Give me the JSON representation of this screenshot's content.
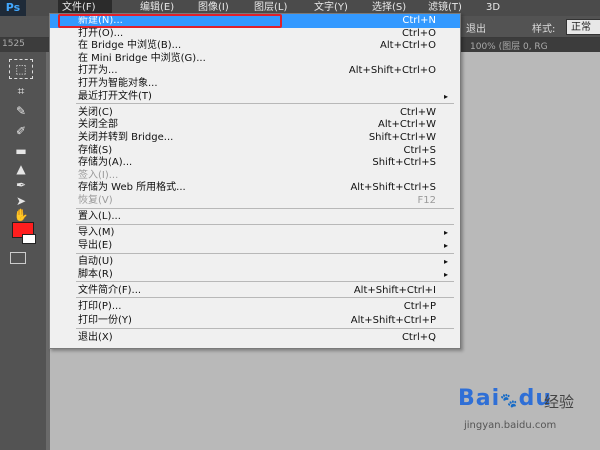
{
  "app": {
    "logo": "Ps"
  },
  "menubar": {
    "items": [
      {
        "label": "文件(F)",
        "active": true
      },
      {
        "label": "编辑(E)"
      },
      {
        "label": "图像(I)"
      },
      {
        "label": "图层(L)"
      },
      {
        "label": "文字(Y)"
      },
      {
        "label": "选择(S)"
      },
      {
        "label": "滤镜(T)"
      },
      {
        "label": "3D"
      }
    ]
  },
  "options": {
    "peek_text": "退出",
    "style_label": "样式:",
    "style_value": "正常"
  },
  "tabbar": {
    "left_text": "1525",
    "right_text": "100% (图层 0, RG"
  },
  "tools": {
    "fg_color": "#ff1e1e",
    "bg_color": "#ffffff"
  },
  "file_menu": {
    "items": [
      {
        "label": "新建(N)...",
        "shortcut": "Ctrl+N",
        "highlighted": true
      },
      {
        "label": "打开(O)...",
        "shortcut": "Ctrl+O"
      },
      {
        "label": "在 Bridge 中浏览(B)...",
        "shortcut": "Alt+Ctrl+O"
      },
      {
        "label": "在 Mini Bridge 中浏览(G)...",
        "shortcut": ""
      },
      {
        "label": "打开为...",
        "shortcut": "Alt+Shift+Ctrl+O"
      },
      {
        "label": "打开为智能对象...",
        "shortcut": ""
      },
      {
        "label": "最近打开文件(T)",
        "shortcut": "",
        "submenu": true
      },
      {
        "label": "关闭(C)",
        "shortcut": "Ctrl+W"
      },
      {
        "label": "关闭全部",
        "shortcut": "Alt+Ctrl+W"
      },
      {
        "label": "关闭并转到 Bridge...",
        "shortcut": "Shift+Ctrl+W"
      },
      {
        "label": "存储(S)",
        "shortcut": "Ctrl+S"
      },
      {
        "label": "存储为(A)...",
        "shortcut": "Shift+Ctrl+S"
      },
      {
        "label": "签入(I)...",
        "shortcut": "",
        "disabled": true
      },
      {
        "label": "存储为 Web 所用格式...",
        "shortcut": "Alt+Shift+Ctrl+S"
      },
      {
        "label": "恢复(V)",
        "shortcut": "F12",
        "disabled": true
      },
      {
        "label": "置入(L)...",
        "shortcut": ""
      },
      {
        "label": "导入(M)",
        "shortcut": "",
        "submenu": true
      },
      {
        "label": "导出(E)",
        "shortcut": "",
        "submenu": true
      },
      {
        "label": "自动(U)",
        "shortcut": "",
        "submenu": true
      },
      {
        "label": "脚本(R)",
        "shortcut": "",
        "submenu": true
      },
      {
        "label": "文件简介(F)...",
        "shortcut": "Alt+Shift+Ctrl+I"
      },
      {
        "label": "打印(P)...",
        "shortcut": "Ctrl+P"
      },
      {
        "label": "打印一份(Y)",
        "shortcut": "Alt+Shift+Ctrl+P"
      },
      {
        "label": "退出(X)",
        "shortcut": "Ctrl+Q"
      }
    ],
    "submenu_glyph": "▸"
  },
  "watermark": {
    "brand": "Bai",
    "brand2": "du",
    "product": "经验",
    "url": "jingyan.baidu.com"
  }
}
